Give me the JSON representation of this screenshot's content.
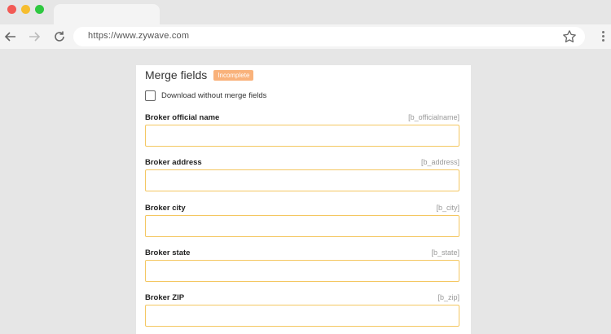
{
  "browser": {
    "url": "https://www.zywave.com",
    "icons": [
      "back-arrow-icon",
      "forward-arrow-icon",
      "reload-icon",
      "star-icon",
      "menu-dots-icon"
    ]
  },
  "form": {
    "title": "Merge fields",
    "status_badge": "Incomplete",
    "download_checkbox": {
      "label": "Download without merge fields",
      "checked": false
    },
    "fields": [
      {
        "label": "Broker official name",
        "token": "[b_officialname]",
        "value": ""
      },
      {
        "label": "Broker address",
        "token": "[b_address]",
        "value": ""
      },
      {
        "label": "Broker city",
        "token": "[b_city]",
        "value": ""
      },
      {
        "label": "Broker state",
        "token": "[b_state]",
        "value": ""
      },
      {
        "label": "Broker ZIP",
        "token": "[b_zip]",
        "value": ""
      }
    ]
  },
  "colors": {
    "badge": "#f9b27b",
    "input_border": "#f4c761",
    "background": "#e6e6e6"
  }
}
